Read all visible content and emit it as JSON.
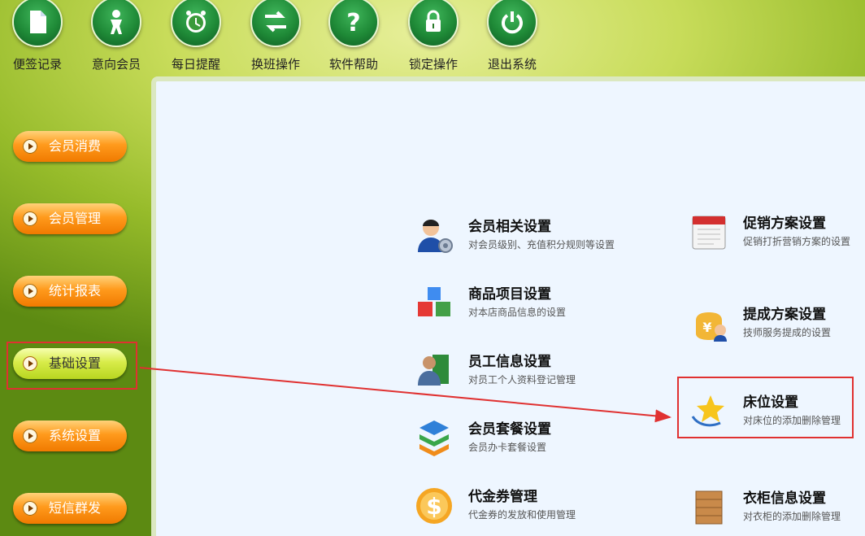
{
  "toolbar": {
    "items": [
      {
        "label": "便签记录",
        "icon": "document-icon"
      },
      {
        "label": "意向会员",
        "icon": "person-icon"
      },
      {
        "label": "每日提醒",
        "icon": "alarm-clock-icon"
      },
      {
        "label": "换班操作",
        "icon": "swap-arrows-icon"
      },
      {
        "label": "软件帮助",
        "icon": "question-icon"
      },
      {
        "label": "锁定操作",
        "icon": "lock-icon"
      },
      {
        "label": "退出系统",
        "icon": "power-icon"
      }
    ]
  },
  "sidebar": {
    "items": [
      {
        "label": "会员消费"
      },
      {
        "label": "会员管理"
      },
      {
        "label": "统计报表"
      },
      {
        "label": "基础设置",
        "active": true
      },
      {
        "label": "系统设置"
      },
      {
        "label": "短信群发"
      }
    ]
  },
  "settings": {
    "left": [
      {
        "title": "会员相关设置",
        "desc": "对会员级别、充值积分规则等设置",
        "icon": "member-settings-icon"
      },
      {
        "title": "商品项目设置",
        "desc": "对本店商品信息的设置",
        "icon": "cubes-icon"
      },
      {
        "title": "员工信息设置",
        "desc": "对员工个人资料登记管理",
        "icon": "employee-book-icon"
      },
      {
        "title": "会员套餐设置",
        "desc": "会员办卡套餐设置",
        "icon": "stacked-layers-icon"
      },
      {
        "title": "代金券管理",
        "desc": "代金券的发放和使用管理",
        "icon": "dollar-coin-icon"
      }
    ],
    "right": [
      {
        "title": "促销方案设置",
        "desc": "促销打折营销方案的设置",
        "icon": "calendar-icon"
      },
      {
        "title": "提成方案设置",
        "desc": "技师服务提成的设置",
        "icon": "money-bag-icon"
      },
      {
        "title": "床位设置",
        "desc": "对床位的添加删除管理",
        "icon": "star-icon"
      },
      {
        "title": "衣柜信息设置",
        "desc": "对衣柜的添加删除管理",
        "icon": "wooden-cabinet-icon"
      }
    ]
  },
  "colors": {
    "accent_red": "#e03131",
    "active_button": "#d8ec4a",
    "button_orange": "#ff9a1c"
  }
}
